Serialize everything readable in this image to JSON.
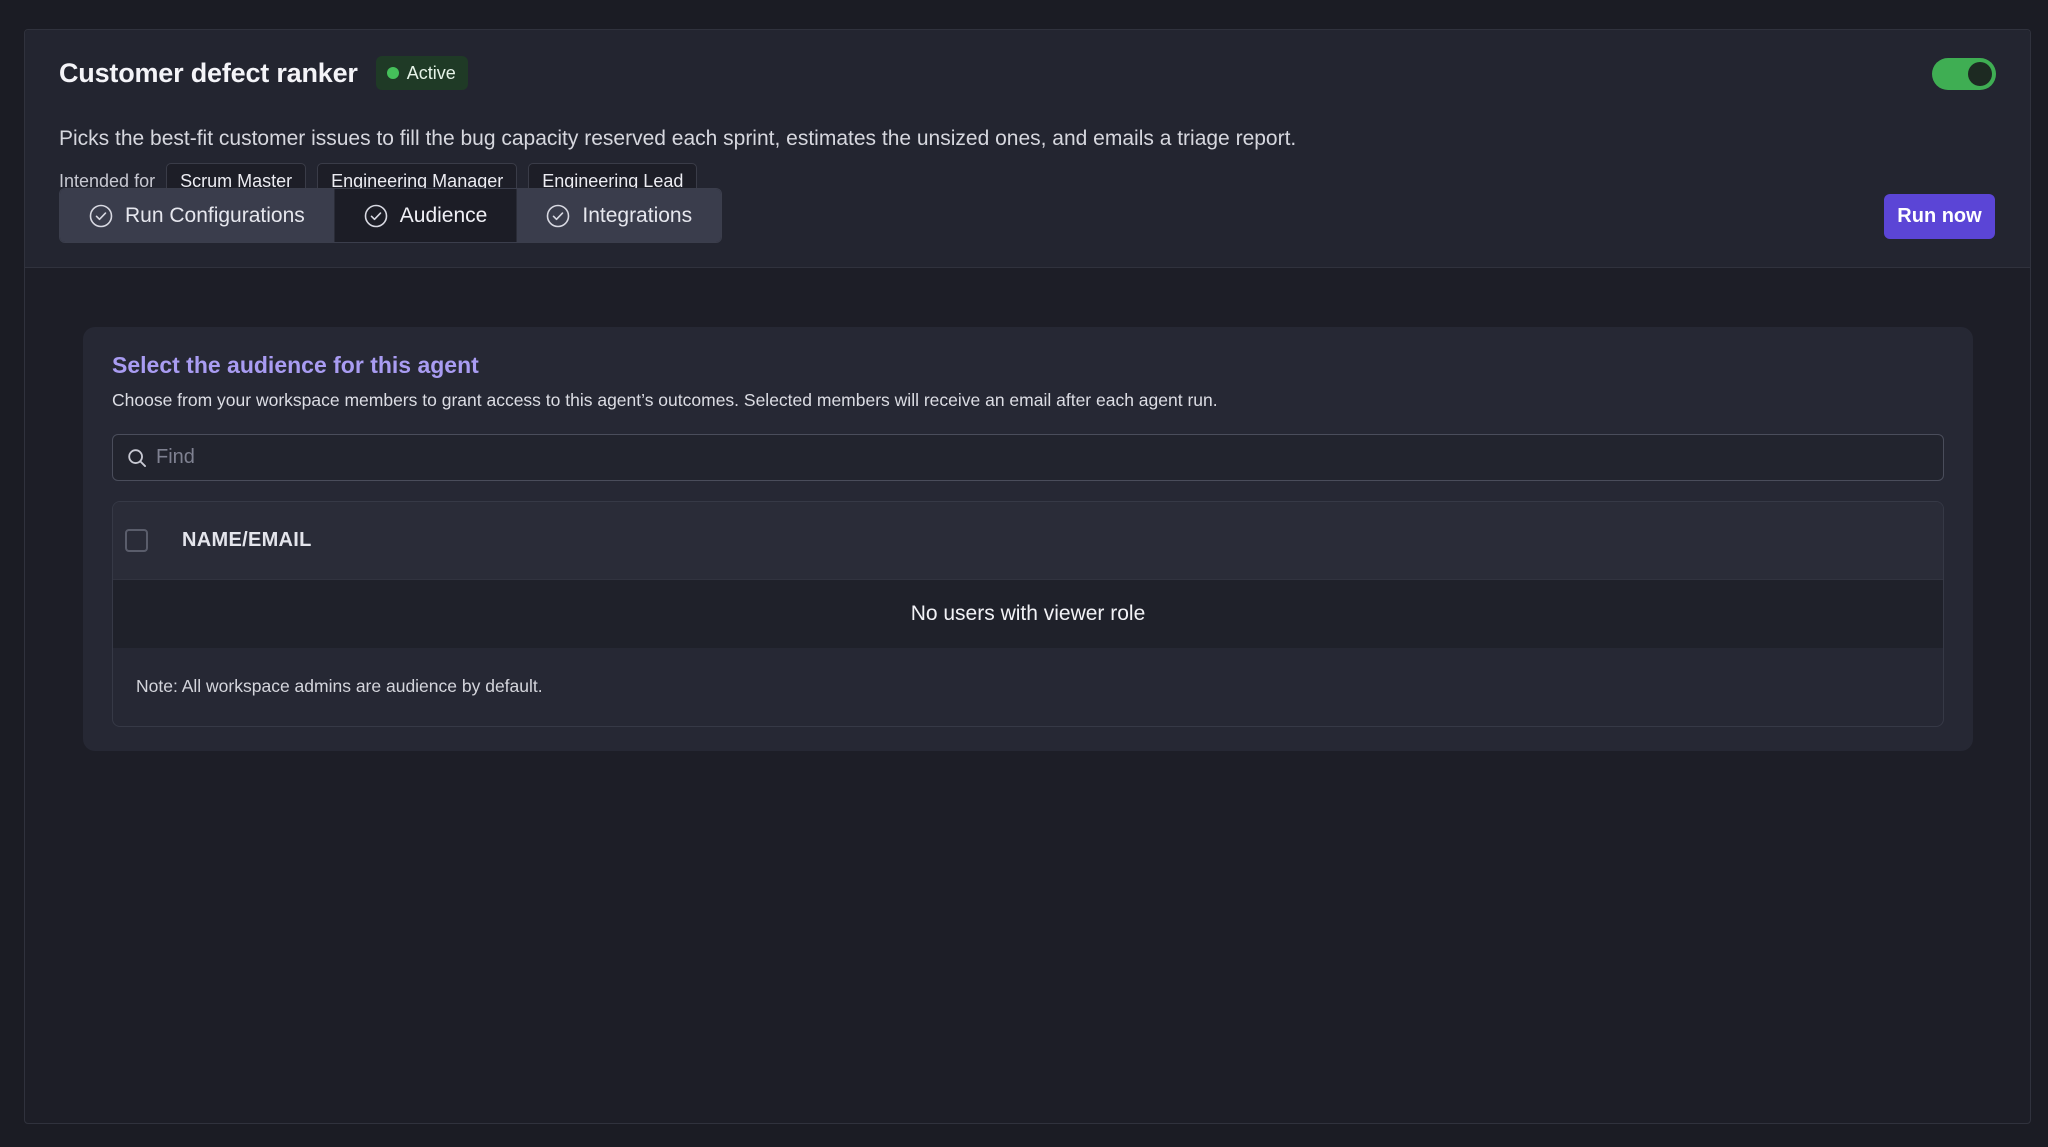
{
  "agent": {
    "title": "Customer defect ranker",
    "status": "Active",
    "description": "Picks the best-fit customer issues to fill the bug capacity reserved each sprint, estimates the unsized ones, and emails a triage report.",
    "intended_label": "Intended for",
    "roles": [
      "Scrum Master",
      "Engineering Manager",
      "Engineering Lead"
    ],
    "enabled": true
  },
  "tabs": [
    {
      "label": "Run Configurations",
      "icon": "check-circle-icon",
      "active": false
    },
    {
      "label": "Audience",
      "icon": "check-circle-icon",
      "active": true
    },
    {
      "label": "Integrations",
      "icon": "check-circle-icon",
      "active": false
    }
  ],
  "run_button": "Run now",
  "audience": {
    "title": "Select the audience for this agent",
    "subtitle": "Choose from your workspace members to grant access to this agent’s outcomes. Selected members will receive an email after each agent run.",
    "search_placeholder": "Find",
    "table": {
      "header": "NAME/EMAIL",
      "empty_message": "No users with viewer role",
      "note": "Note: All workspace admins are audience by default."
    }
  },
  "colors": {
    "accent": "#5b45d6",
    "heading_accent": "#a99cf2",
    "active_green": "#45c05a",
    "toggle_on": "#3fae53"
  }
}
